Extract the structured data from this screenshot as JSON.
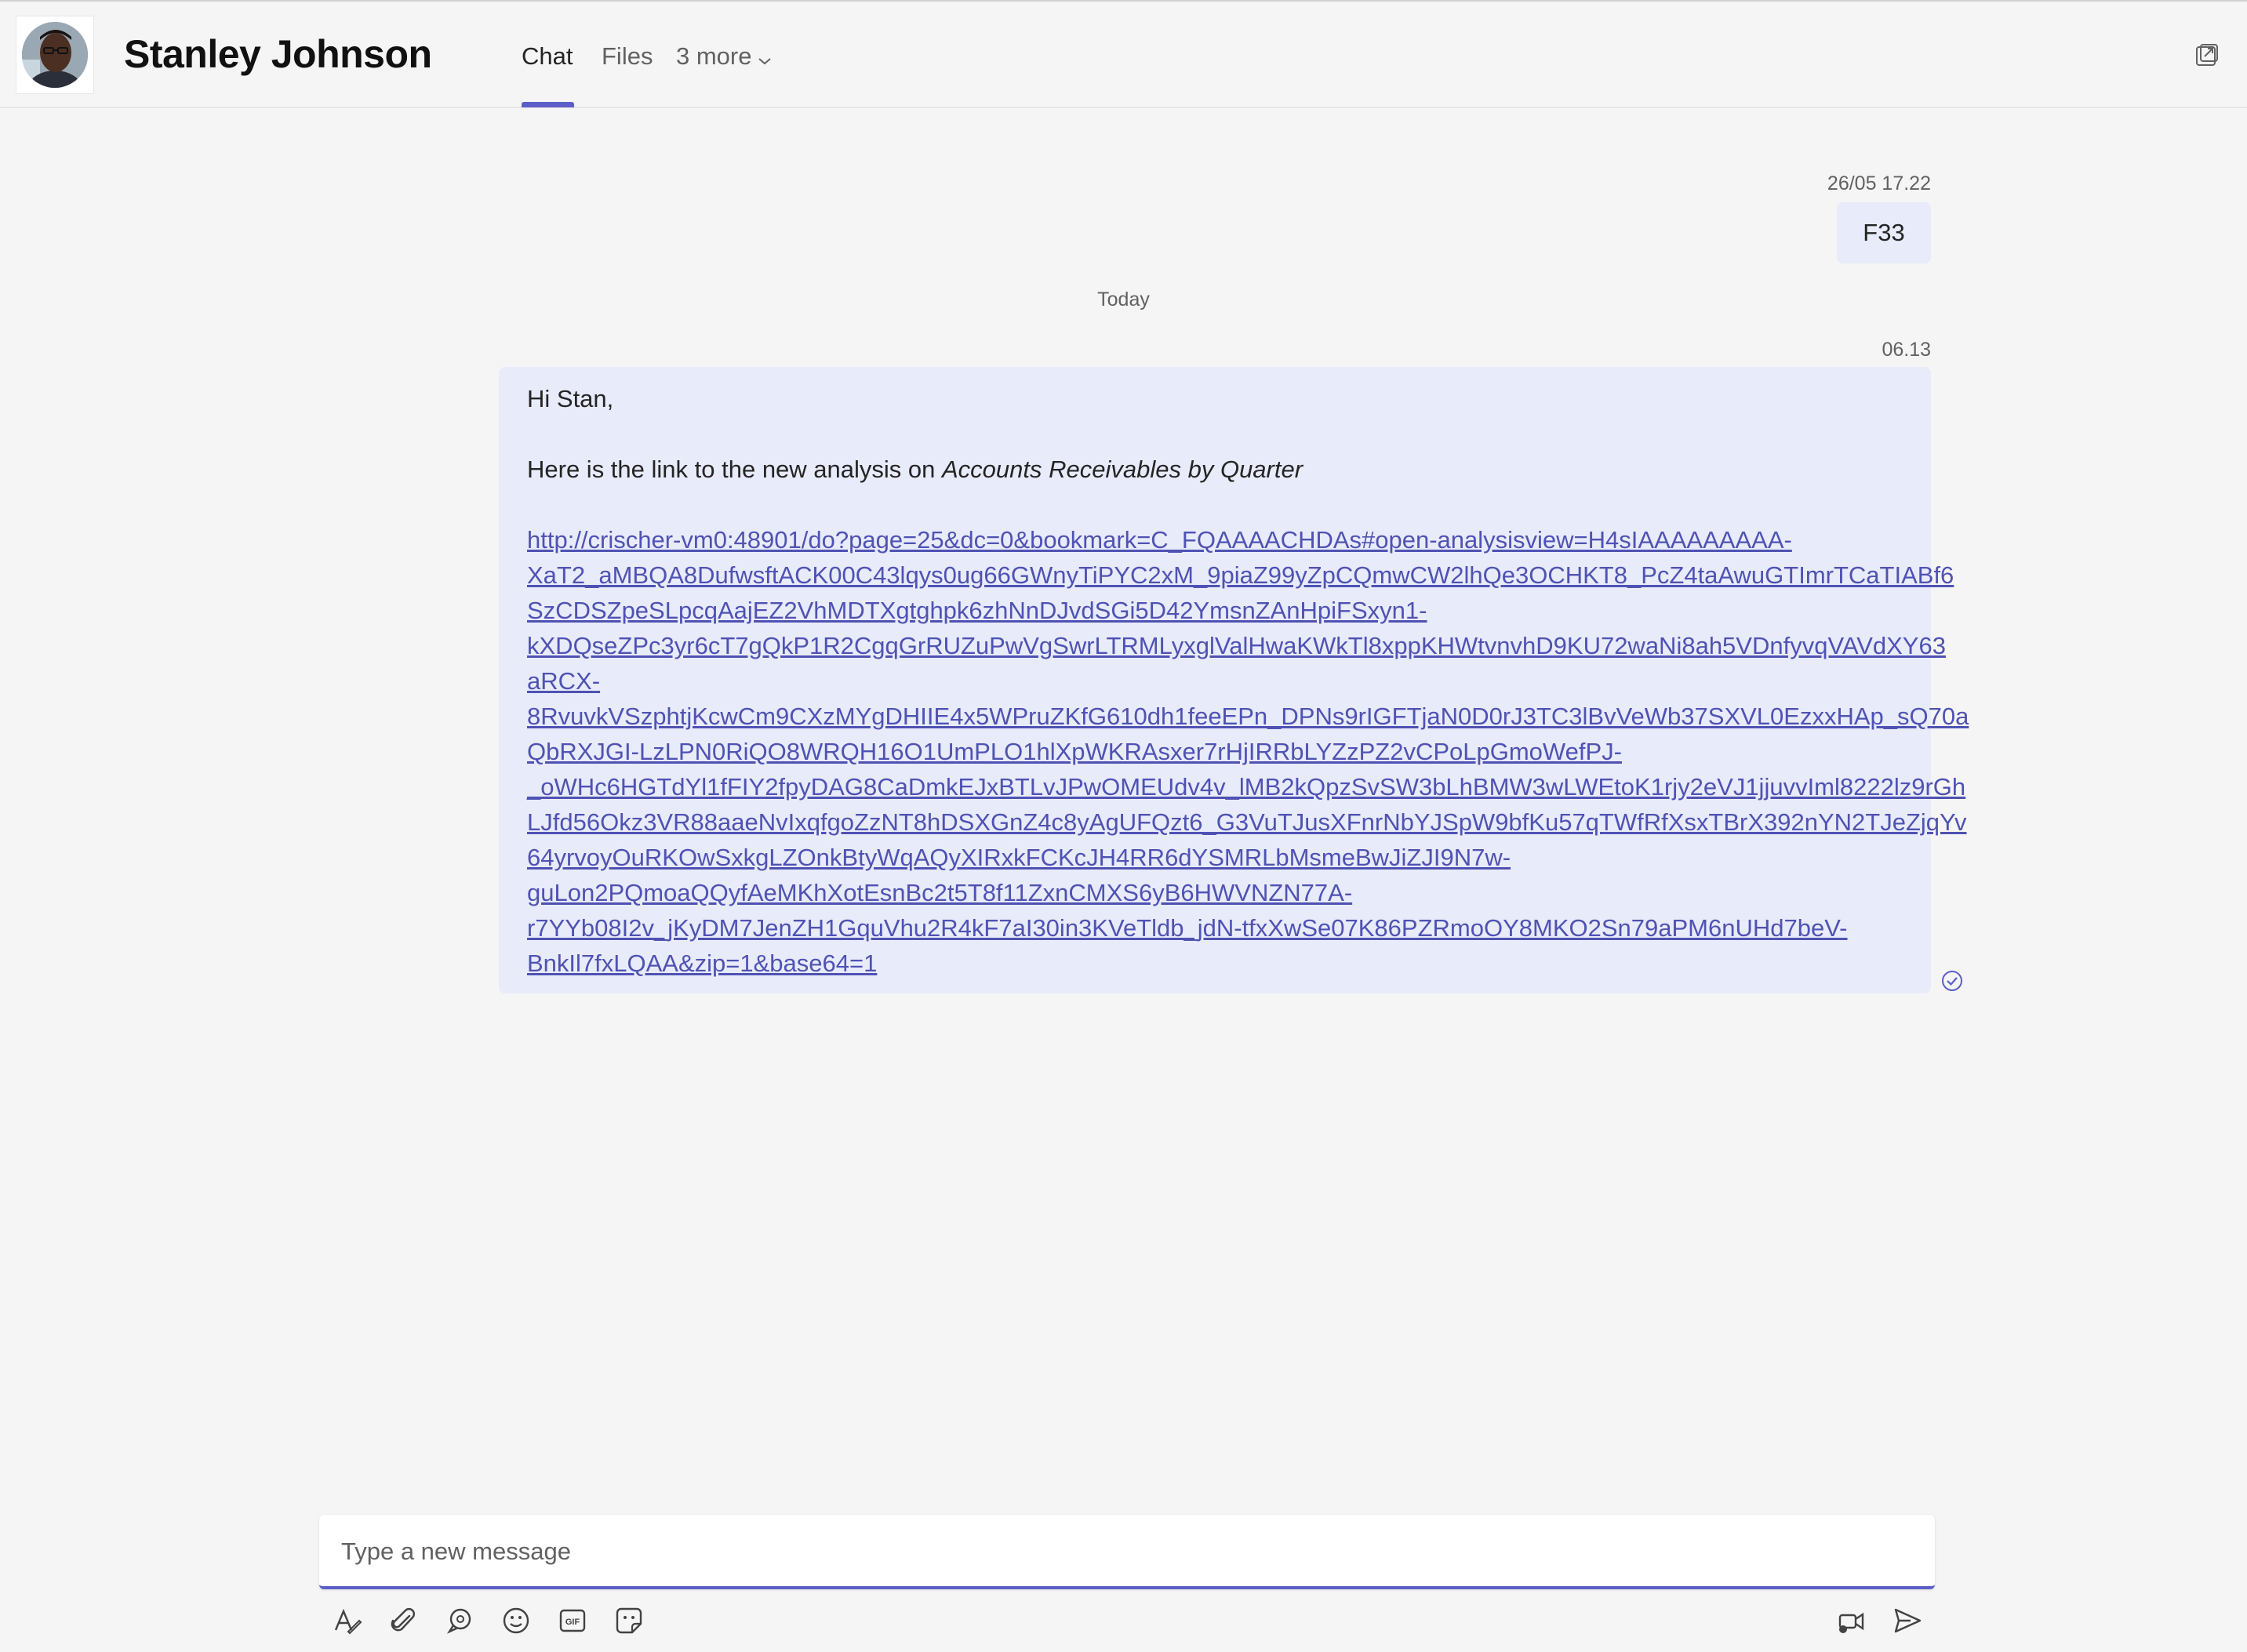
{
  "header": {
    "contact_name": "Stanley Johnson",
    "tabs": [
      {
        "label": "Chat"
      },
      {
        "label": "Files"
      },
      {
        "label": "3 more"
      }
    ]
  },
  "messages": {
    "first": {
      "timestamp": "26/05 17.22",
      "text": "F33"
    },
    "day_divider": "Today",
    "second": {
      "timestamp": "06.13",
      "greeting": "Hi Stan,",
      "intro": "Here is the link to the new analysis on ",
      "intro_italic": "Accounts Receivables by Quarter",
      "link_lines": [
        "http://crischer-vm0:48901/do?page=25&dc=0&bookmark=C_FQAAAACHDAs#open-analysisview=H4sIAAAAAAAAA-",
        "XaT2_aMBQA8DufwsftACK00C43lqys0ug66GWnyTiPYC2xM_9piaZ99yZpCQmwCW2lhQe3OCHKT8_PcZ4taAwuGTImrTCaTIABf6",
        "SzCDSZpeSLpcqAajEZ2VhMDTXgtghpk6zhNnDJvdSGi5D42YmsnZAnHpiFSxyn1-",
        "kXDQseZPc3yr6cT7gQkP1R2CgqGrRUZuPwVgSwrLTRMLyxglValHwaKWkTl8xppKHWtvnvhD9KU72waNi8ah5VDnfyvqVAVdXY63",
        "aRCX-",
        "8RvuvkVSzphtjKcwCm9CXzMYgDHIIE4x5WPruZKfG610dh1feeEPn_DPNs9rIGFTjaN0D0rJ3TC3lBvVeWb37SXVL0EzxxHAp_sQ70a",
        "QbRXJGI-LzLPN0RiQO8WRQH16O1UmPLO1hlXpWKRAsxer7rHjIRRbLYZzPZ2vCPoLpGmoWefPJ-",
        "_oWHc6HGTdYl1fFIY2fpyDAG8CaDmkEJxBTLvJPwOMEUdv4v_lMB2kQpzSvSW3bLhBMW3wLWEtoK1rjy2eVJ1jjuvvIml8222lz9rGh",
        "LJfd56Okz3VR88aaeNvIxqfgoZzNT8hDSXGnZ4c8yAgUFQzt6_G3VuTJusXFnrNbYJSpW9bfKu57qTWfRfXsxTBrX392nYN2TJeZjqYv",
        "64yrvoyOuRKOwSxkgLZOnkBtyWqAQyXIRxkFCKcJH4RR6dYSMRLbMsmeBwJiZJI9N7w-",
        "guLon2PQmoaQQyfAeMKhXotEsnBc2t5T8f11ZxnCMXS6yB6HWVNZN77A-",
        "r7YYb08I2v_jKyDM7JenZH1GquVhu2R4kF7aI30in3KVeTldb_jdN-tfxXwSe07K86PZRmoOY8MKO2Sn79aPM6nUHd7beV-",
        "BnkIl7fxLQAA&zip=1&base64=1"
      ]
    }
  },
  "compose": {
    "placeholder": "Type a new message"
  },
  "toolbar_icons": [
    "format-icon",
    "attach-icon",
    "loop-icon",
    "emoji-icon",
    "gif-icon",
    "sticker-icon",
    "meet-now-icon",
    "send-icon"
  ],
  "colors": {
    "accent": "#5b5fc7",
    "bubble": "#e8ebfa",
    "link": "#4f52b2",
    "background": "#f5f5f5"
  }
}
